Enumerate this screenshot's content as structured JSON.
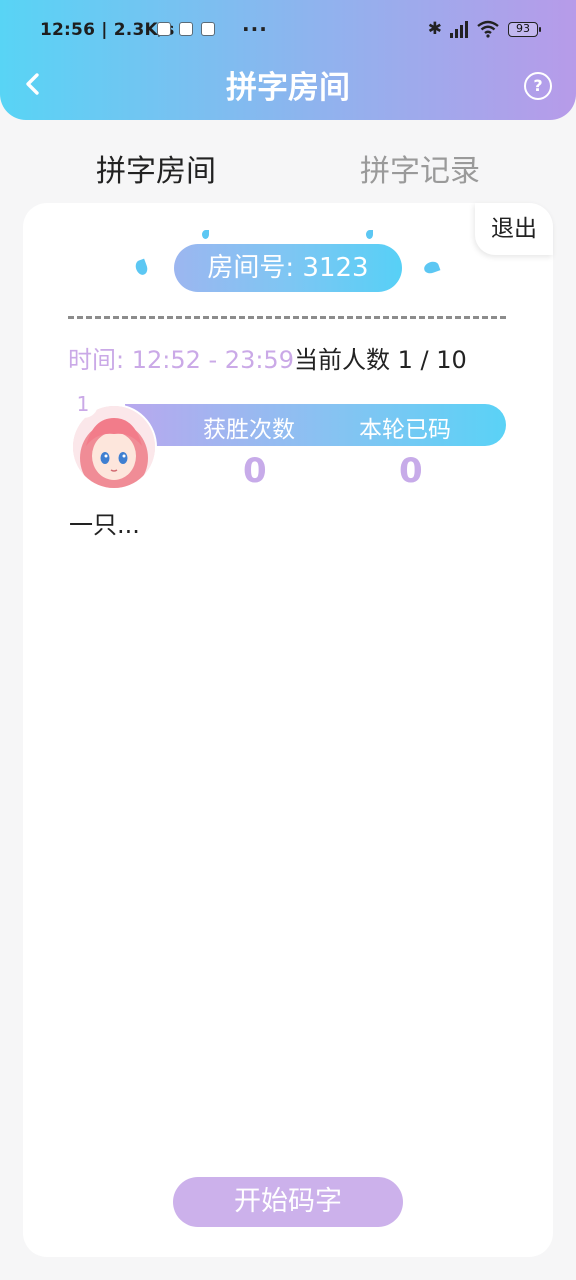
{
  "status_bar": {
    "time": "12:56 | 2.3K/s",
    "more": "···",
    "battery": "93"
  },
  "nav": {
    "title": "拼字房间",
    "help": "?"
  },
  "tabs": [
    {
      "label": "拼字房间",
      "active": true
    },
    {
      "label": "拼字记录",
      "active": false
    }
  ],
  "room": {
    "exit_label": "退出",
    "room_number": "房间号: 3123",
    "time_range": "时间: 12:52 - 23:59",
    "player_count": "当前人数 1 / 10"
  },
  "player": {
    "rank": "1",
    "wins_label": "获胜次数",
    "round_label": "本轮已码",
    "wins_value": "0",
    "round_value": "0",
    "name": "一只..."
  },
  "actions": {
    "start_label": "开始码字"
  },
  "colors": {
    "header_gradient_start": "#58d4f5",
    "header_gradient_end": "#b79be9",
    "accent_purple": "#caa9e7",
    "start_button": "#ccb1eb"
  }
}
